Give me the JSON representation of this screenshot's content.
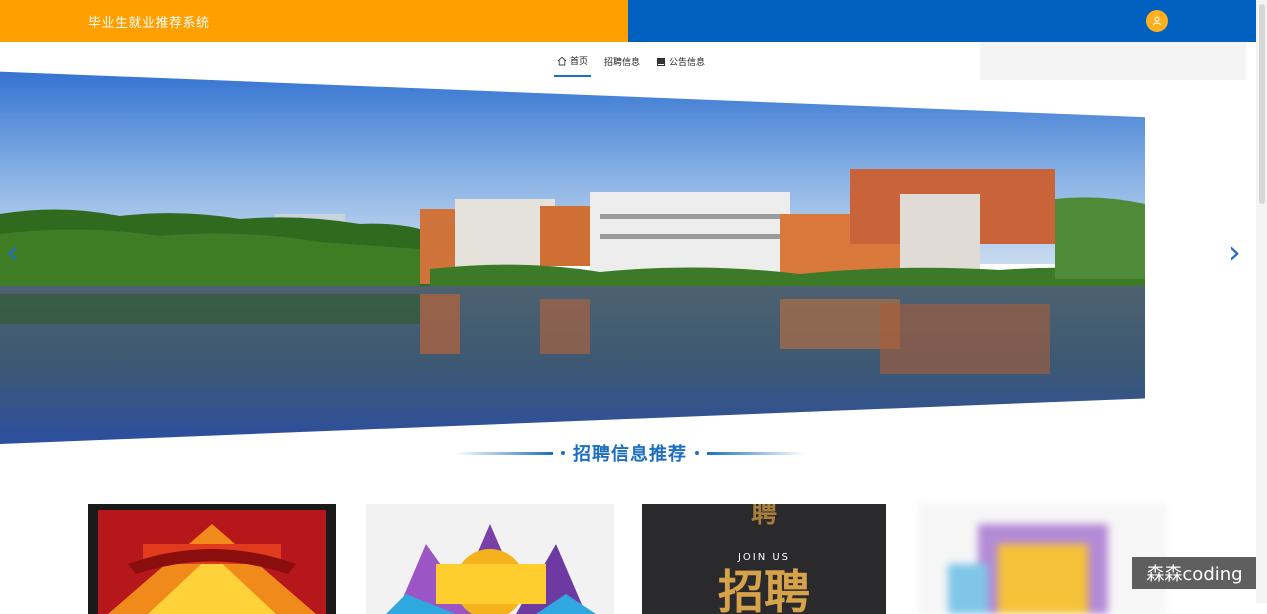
{
  "header": {
    "title": "毕业生就业推荐系统",
    "avatar_icon": "user-icon"
  },
  "nav": {
    "items": [
      {
        "label": "首页",
        "icon": "home-icon",
        "active": true
      },
      {
        "label": "招聘信息",
        "icon": "",
        "active": false
      },
      {
        "label": "公告信息",
        "icon": "book-icon",
        "active": false
      }
    ]
  },
  "banner": {
    "prev_icon": "chevron-left-icon",
    "next_icon": "chevron-right-icon"
  },
  "section": {
    "title": "招聘信息推荐"
  },
  "cards": [
    {
      "image": "poster-zhaopin-red"
    },
    {
      "image": "poster-rencai"
    },
    {
      "image": "poster-join-us",
      "text_en": "JOIN US",
      "text_cn": "招聘"
    },
    {
      "image": "poster-blurred"
    }
  ],
  "watermark": "森森coding",
  "colors": {
    "header_left": "#FF9F00",
    "header_right": "#0060BF",
    "accent": "#1E6FC0"
  }
}
